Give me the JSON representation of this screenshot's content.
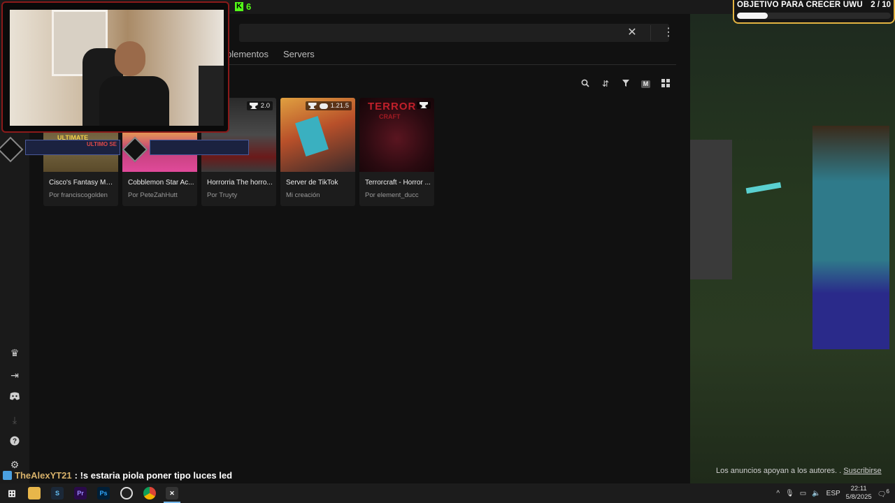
{
  "overlay": {
    "goal_label": "OBJETIVO PARA CRECER UWU",
    "goal_count": "2 / 10",
    "goal_progress": 0.2,
    "kick_count": "6",
    "chat": {
      "user": "TheAlexYT21",
      "message": ": !s estaria piola poner tipo luces led"
    }
  },
  "app": {
    "tabs": [
      "plementos",
      "Servers"
    ],
    "toolbar_icons": [
      "search-icon",
      "sort-icon",
      "filter-icon",
      "m-icon",
      "grid-icon"
    ],
    "toolbar_m_label": "M",
    "cards": [
      {
        "title": "Cisco's Fantasy Med...",
        "author": "Por franciscogolden",
        "badge": "",
        "thumb_color": "#6b5a3a"
      },
      {
        "title": "Cobblemon Star Ac...",
        "author": "Por PeteZahHutt",
        "badge": "",
        "thumb_color": "#c2407a"
      },
      {
        "title": "Horrorria The horro...",
        "author": "Por Truyty",
        "badge": "2.0",
        "thumb_color": "#3a3a3a"
      },
      {
        "title": "Server de TikTok",
        "author": "Mi creación",
        "badge": "1.21.5",
        "thumb_color": "#8a4a2a"
      },
      {
        "title": "Terrorcraft - Horror ...",
        "author": "Por element_ducc",
        "badge": "",
        "thumb_color": "#3a0d12"
      }
    ],
    "card_overlay_texts": [
      "ULTIMATE",
      "ULTIMO SE",
      "TERROR",
      "CRAFT"
    ],
    "ads_text": "Los anuncios apoyan a los autores. .",
    "ads_link": "Suscribirse"
  },
  "taskbar": {
    "language": "ESP",
    "time": "22:11",
    "date": "5/8/2025",
    "notification_count": "6",
    "apps": [
      "windows-start-icon",
      "file-explorer-icon",
      "steam-icon",
      "premiere-icon",
      "photoshop-icon",
      "obs-icon",
      "chrome-icon",
      "curseforge-icon"
    ],
    "app_labels": {
      "premiere": "Pr",
      "photoshop": "Ps"
    }
  },
  "colors": {
    "goal_border": "#e3b341",
    "kick_green": "#53fc18",
    "chat_user": "#d7b16a",
    "taskbar_accent": "#76b9ed",
    "cam_border": "#8b1a1a"
  }
}
